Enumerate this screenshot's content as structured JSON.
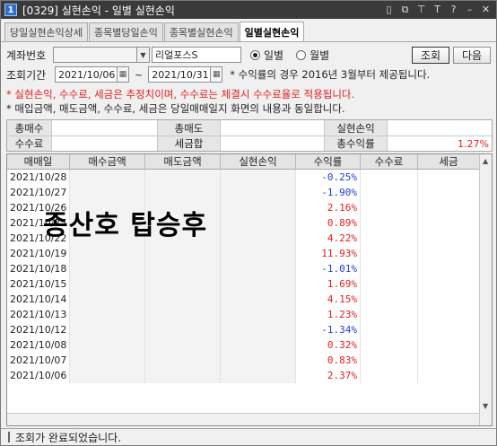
{
  "window": {
    "app_number": "1",
    "title": "[0329] 실현손익 - 일별 실현손익",
    "icons": [
      "window-icon",
      "copy-icon",
      "pin-icon",
      "text-icon",
      "help-icon",
      "minimize-icon",
      "close-icon"
    ]
  },
  "tabs": [
    {
      "label": "당일실현손익상세"
    },
    {
      "label": "종목별당일손익"
    },
    {
      "label": "종목별실현손익"
    },
    {
      "label": "일별실현손익",
      "active": true
    }
  ],
  "form": {
    "account_label": "계좌번호",
    "account_value": "",
    "account_name": "리얼포스S",
    "radio_daily": "일별",
    "radio_monthly": "월별",
    "selected": "일별",
    "query_button": "조회",
    "next_button": "다음",
    "period_label": "조회기간",
    "date_from": "2021/10/06",
    "range_sep": "~",
    "date_to": "2021/10/31",
    "period_note": "* 수익률의 경우 2016년 3월부터 제공됩니다."
  },
  "notices": {
    "line1": "* 실현손익, 수수료, 세금은 추정치이며, 수수료는 체결시 수수료율로 적용됩니다.",
    "line2": "* 매입금액, 매도금액, 수수료, 세금은 당일매매일지 화면의 내용과 동일합니다."
  },
  "summary": {
    "buy_total_label": "총매수",
    "buy_total_value": "",
    "sell_total_label": "총매도",
    "sell_total_value": "",
    "realized_label": "실현손익",
    "realized_value": "",
    "fee_label": "수수료",
    "fee_value": "",
    "tax_label": "세금합",
    "tax_value": "",
    "return_label": "총수익률",
    "return_value": "1.27%"
  },
  "table": {
    "columns": [
      "매매일",
      "매수금액",
      "매도금액",
      "실현손익",
      "수익률",
      "수수료",
      "세금"
    ],
    "rows": [
      {
        "date": "2021/10/28",
        "rate": "-0.25%"
      },
      {
        "date": "2021/10/27",
        "rate": "-1.90%"
      },
      {
        "date": "2021/10/26",
        "rate": "2.16%"
      },
      {
        "date": "2021/10/25",
        "rate": "0.89%"
      },
      {
        "date": "2021/10/22",
        "rate": "4.22%"
      },
      {
        "date": "2021/10/19",
        "rate": "11.93%"
      },
      {
        "date": "2021/10/18",
        "rate": "-1.01%"
      },
      {
        "date": "2021/10/15",
        "rate": "1.69%"
      },
      {
        "date": "2021/10/14",
        "rate": "4.15%"
      },
      {
        "date": "2021/10/13",
        "rate": "1.23%"
      },
      {
        "date": "2021/10/12",
        "rate": "-1.34%"
      },
      {
        "date": "2021/10/08",
        "rate": "0.32%"
      },
      {
        "date": "2021/10/07",
        "rate": "0.83%"
      },
      {
        "date": "2021/10/06",
        "rate": "2.37%"
      }
    ]
  },
  "overlay_text": "종산호 탑승후",
  "status": "조회가 완료되었습니다.",
  "colors": {
    "positive": "#e02020",
    "negative": "#1f3fd0",
    "notice_red": "#e02020"
  }
}
